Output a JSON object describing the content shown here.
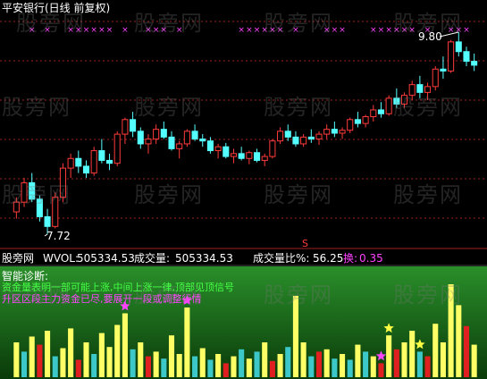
{
  "title": "平安银行(日线 前复权)",
  "watermark_text": "股旁网",
  "price_panel": {
    "high_label": "9.80",
    "low_label": "7.72",
    "marker_symbol": "×"
  },
  "info_bar": {
    "source": "股旁网",
    "vol_label": "WVOL:",
    "vol_value": "505334.53",
    "turnover_label": "成交量:",
    "turnover_value": "505334.53",
    "ratio_label": "成交量比%:",
    "ratio_value": "56.25",
    "change_label": "换:",
    "change_value": "0.35",
    "s_marker": "S"
  },
  "diagnosis": {
    "heading": "智能诊断:",
    "line1": "资金量表明一部可能上涨,中间上涨一律,顶部见顶信号",
    "line2": "升区区段主力资金已尽,要展开一段或调整行情"
  },
  "colors": {
    "up": "#ff3b3b",
    "down": "#54ffff",
    "title": "#ffffff",
    "marker": "#ff44ff",
    "vol_yellow": "#ffff66",
    "vol_cyan": "#3cc8c8",
    "vol_red": "#e02020",
    "star": "#ff44ff",
    "star_yellow": "#ffff44",
    "info_white": "#ffffff",
    "info_yellow": "#ffff44",
    "info_magenta": "#ff44ff",
    "diag_green": "#44ff44",
    "diag_magenta": "#ff44ff",
    "grid": "#a02020"
  },
  "chart_data": {
    "type": "candlestick_with_volume",
    "price_range": [
      7.72,
      9.8
    ],
    "candles": [
      [
        7.95,
        8.1,
        7.88,
        8.05
      ],
      [
        8.05,
        8.3,
        8.0,
        8.25
      ],
      [
        8.25,
        8.35,
        8.05,
        8.08
      ],
      [
        8.08,
        8.12,
        7.85,
        7.9
      ],
      [
        7.9,
        7.98,
        7.72,
        7.8
      ],
      [
        7.8,
        8.15,
        7.78,
        8.1
      ],
      [
        8.1,
        8.45,
        8.05,
        8.4
      ],
      [
        8.4,
        8.55,
        8.3,
        8.5
      ],
      [
        8.5,
        8.58,
        8.35,
        8.42
      ],
      [
        8.42,
        8.48,
        8.3,
        8.35
      ],
      [
        8.35,
        8.62,
        8.32,
        8.58
      ],
      [
        8.58,
        8.7,
        8.45,
        8.48
      ],
      [
        8.48,
        8.55,
        8.38,
        8.45
      ],
      [
        8.45,
        8.78,
        8.42,
        8.75
      ],
      [
        8.75,
        8.92,
        8.65,
        8.9
      ],
      [
        8.9,
        8.98,
        8.72,
        8.78
      ],
      [
        8.78,
        8.82,
        8.6,
        8.65
      ],
      [
        8.65,
        8.75,
        8.55,
        8.7
      ],
      [
        8.7,
        8.85,
        8.65,
        8.8
      ],
      [
        8.8,
        8.88,
        8.7,
        8.72
      ],
      [
        8.72,
        8.78,
        8.58,
        8.6
      ],
      [
        8.6,
        8.68,
        8.5,
        8.65
      ],
      [
        8.65,
        8.8,
        8.62,
        8.78
      ],
      [
        8.78,
        8.85,
        8.68,
        8.7
      ],
      [
        8.7,
        8.75,
        8.62,
        8.68
      ],
      [
        8.68,
        8.72,
        8.55,
        8.58
      ],
      [
        8.58,
        8.65,
        8.5,
        8.62
      ],
      [
        8.62,
        8.66,
        8.5,
        8.52
      ],
      [
        8.52,
        8.6,
        8.45,
        8.55
      ],
      [
        8.55,
        8.62,
        8.48,
        8.5
      ],
      [
        8.5,
        8.58,
        8.44,
        8.56
      ],
      [
        8.56,
        8.6,
        8.46,
        8.48
      ],
      [
        8.48,
        8.55,
        8.42,
        8.52
      ],
      [
        8.52,
        8.7,
        8.5,
        8.68
      ],
      [
        8.68,
        8.82,
        8.65,
        8.78
      ],
      [
        8.78,
        8.85,
        8.68,
        8.72
      ],
      [
        8.72,
        8.78,
        8.62,
        8.65
      ],
      [
        8.65,
        8.75,
        8.62,
        8.72
      ],
      [
        8.72,
        8.8,
        8.66,
        8.7
      ],
      [
        8.7,
        8.78,
        8.64,
        8.75
      ],
      [
        8.75,
        8.85,
        8.7,
        8.8
      ],
      [
        8.8,
        8.88,
        8.72,
        8.76
      ],
      [
        8.76,
        8.82,
        8.7,
        8.79
      ],
      [
        8.79,
        8.92,
        8.76,
        8.9
      ],
      [
        8.9,
        8.98,
        8.82,
        8.86
      ],
      [
        8.86,
        8.95,
        8.82,
        8.93
      ],
      [
        8.93,
        9.05,
        8.88,
        9.0
      ],
      [
        9.0,
        9.08,
        8.92,
        8.96
      ],
      [
        8.96,
        9.15,
        8.94,
        9.12
      ],
      [
        9.12,
        9.22,
        9.02,
        9.06
      ],
      [
        9.06,
        9.18,
        9.02,
        9.15
      ],
      [
        9.15,
        9.3,
        9.1,
        9.26
      ],
      [
        9.26,
        9.35,
        9.12,
        9.18
      ],
      [
        9.18,
        9.28,
        9.1,
        9.24
      ],
      [
        9.24,
        9.45,
        9.2,
        9.42
      ],
      [
        9.42,
        9.55,
        9.32,
        9.4
      ],
      [
        9.4,
        9.72,
        9.38,
        9.7
      ],
      [
        9.7,
        9.8,
        9.55,
        9.6
      ],
      [
        9.6,
        9.65,
        9.45,
        9.5
      ],
      [
        9.5,
        9.58,
        9.4,
        9.46
      ]
    ],
    "volume": [
      [
        30,
        "vol_yellow"
      ],
      [
        22,
        "vol_cyan"
      ],
      [
        35,
        "vol_yellow"
      ],
      [
        28,
        "vol_red"
      ],
      [
        40,
        "vol_yellow"
      ],
      [
        18,
        "vol_cyan"
      ],
      [
        25,
        "vol_yellow"
      ],
      [
        42,
        "vol_yellow"
      ],
      [
        15,
        "vol_red"
      ],
      [
        30,
        "vol_yellow"
      ],
      [
        20,
        "vol_cyan"
      ],
      [
        38,
        "vol_yellow"
      ],
      [
        26,
        "vol_yellow"
      ],
      [
        45,
        "vol_yellow"
      ],
      [
        55,
        "vol_yellow"
      ],
      [
        24,
        "vol_cyan"
      ],
      [
        30,
        "vol_yellow"
      ],
      [
        18,
        "vol_red"
      ],
      [
        22,
        "vol_yellow"
      ],
      [
        16,
        "vol_cyan"
      ],
      [
        36,
        "vol_yellow"
      ],
      [
        20,
        "vol_yellow"
      ],
      [
        60,
        "vol_yellow"
      ],
      [
        18,
        "vol_cyan"
      ],
      [
        25,
        "vol_yellow"
      ],
      [
        15,
        "vol_cyan"
      ],
      [
        20,
        "vol_yellow"
      ],
      [
        12,
        "vol_red"
      ],
      [
        18,
        "vol_yellow"
      ],
      [
        24,
        "vol_cyan"
      ],
      [
        16,
        "vol_yellow"
      ],
      [
        22,
        "vol_cyan"
      ],
      [
        30,
        "vol_yellow"
      ],
      [
        14,
        "vol_red"
      ],
      [
        20,
        "vol_yellow"
      ],
      [
        26,
        "vol_cyan"
      ],
      [
        70,
        "vol_yellow"
      ],
      [
        30,
        "vol_yellow"
      ],
      [
        18,
        "vol_cyan"
      ],
      [
        22,
        "vol_red"
      ],
      [
        24,
        "vol_yellow"
      ],
      [
        16,
        "vol_cyan"
      ],
      [
        20,
        "vol_yellow"
      ],
      [
        15,
        "vol_cyan"
      ],
      [
        28,
        "vol_yellow"
      ],
      [
        22,
        "vol_cyan"
      ],
      [
        18,
        "vol_yellow"
      ],
      [
        12,
        "vol_red"
      ],
      [
        36,
        "vol_yellow"
      ],
      [
        24,
        "vol_red"
      ],
      [
        30,
        "vol_yellow"
      ],
      [
        40,
        "vol_yellow"
      ],
      [
        22,
        "vol_cyan"
      ],
      [
        18,
        "vol_red"
      ],
      [
        46,
        "vol_yellow"
      ],
      [
        30,
        "vol_yellow"
      ],
      [
        80,
        "vol_yellow"
      ],
      [
        62,
        "vol_yellow"
      ],
      [
        44,
        "vol_red"
      ],
      [
        28,
        "vol_yellow"
      ]
    ],
    "stars": [
      {
        "index": 14,
        "color": "star"
      },
      {
        "index": 22,
        "color": "star"
      },
      {
        "index": 47,
        "color": "star"
      },
      {
        "index": 48,
        "color": "star_yellow"
      },
      {
        "index": 52,
        "color": "star_yellow"
      }
    ],
    "top_markers": [
      2,
      4,
      7,
      8,
      9,
      10,
      11,
      12,
      14,
      17,
      18,
      19,
      21,
      29,
      30,
      31,
      32,
      33,
      34,
      36,
      40,
      41,
      42,
      46,
      47,
      48,
      49,
      50,
      51,
      53,
      56,
      57,
      58
    ]
  }
}
